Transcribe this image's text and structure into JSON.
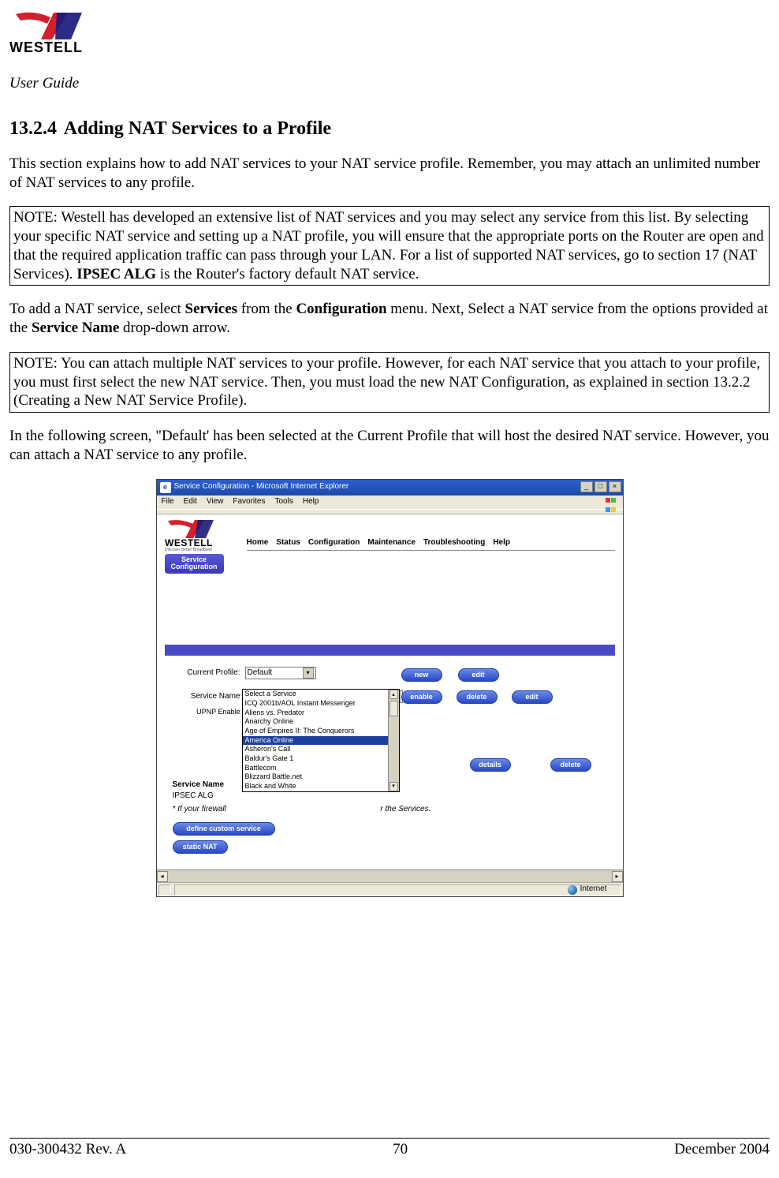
{
  "doc": {
    "type_label": "User Guide",
    "heading_number": "13.2.4",
    "heading_title": "Adding NAT Services to a Profile",
    "intro": "This section explains how to add NAT services to your NAT service profile. Remember, you may attach an unlimited number of NAT services to any profile.",
    "note1_prefix": "NOTE: Westell has developed an extensive list of NAT services and you may select any service from this list. By selecting your specific NAT service and setting up a NAT profile, you will ensure that the appropriate ports on the Router are open and that the required application traffic can pass through your LAN. For a list of supported NAT services, go to section 17 (NAT Services). ",
    "note1_bold": "IPSEC ALG",
    "note1_suffix": " is the Router's factory default NAT service.",
    "para2_a": "To add a NAT service, select ",
    "para2_b": "Services",
    "para2_c": " from the ",
    "para2_d": "Configuration",
    "para2_e": " menu. Next, Select a NAT service from the options provided at the ",
    "para2_f": "Service Name",
    "para2_g": " drop-down arrow.",
    "note2": "NOTE: You can attach multiple NAT services to your profile. However, for each NAT service that you attach to your profile, you must first select the new NAT service. Then, you must load the new NAT Configuration, as explained in section 13.2.2 (Creating a New NAT Service Profile).",
    "para3": "In the following screen, \"Default' has been selected at the Current Profile that will host the desired NAT service. However, you can attach a NAT service to any profile."
  },
  "screenshot": {
    "window_title": "Service Configuration - Microsoft Internet Explorer",
    "menu": {
      "file": "File",
      "edit": "Edit",
      "view": "View",
      "favorites": "Favorites",
      "tools": "Tools",
      "help": "Help"
    },
    "logo_text": "WESTELL",
    "logo_tagline": "Discover Better Broadband",
    "nav": {
      "home": "Home",
      "status": "Status",
      "configuration": "Configuration",
      "maintenance": "Maintenance",
      "troubleshooting": "Troubleshooting",
      "help": "Help"
    },
    "service_config_btn_l1": "Service",
    "service_config_btn_l2": "Configuration",
    "labels": {
      "current_profile": "Current Profile:",
      "service_name": "Service Name",
      "upnp_enable": "UPNP Enable",
      "service_name_hdr": "Service Name",
      "ipsec_alg": "IPSEC ALG"
    },
    "current_profile_value": "Default",
    "service_name_value": "Select a Service",
    "dropdown_options": [
      "Select a Service",
      "ICQ 2001b/AOL Instant Messenger",
      "Aliens vs. Predator",
      "Anarchy Online",
      "Age of Empires II: The Conquerors",
      "America Online",
      "Asheron's Call",
      "Baldur's Gate 1",
      "Battlecom",
      "Blizzard Battle.net",
      "Black and White"
    ],
    "dropdown_selected_index": 5,
    "buttons": {
      "new": "new",
      "edit": "edit",
      "enable": "enable",
      "delete": "delete",
      "details": "details",
      "define_custom": "define custom service",
      "static_nat": "static NAT"
    },
    "firewall_note_prefix": "* If your firewall",
    "firewall_note_suffix": "r the Services.",
    "status_internet": "Internet"
  },
  "footer": {
    "left": "030-300432 Rev. A",
    "center": "70",
    "right": "December 2004"
  }
}
